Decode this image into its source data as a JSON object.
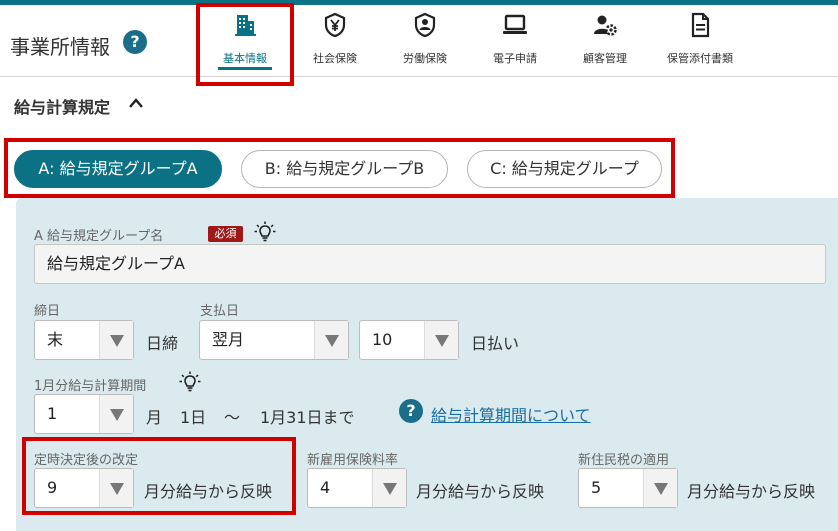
{
  "header": {
    "title": "事業所情報",
    "help_glyph": "?"
  },
  "tabs": [
    {
      "label": "基本情報",
      "icon": "building-icon",
      "active": true
    },
    {
      "label": "社会保険",
      "icon": "yen-shield-icon"
    },
    {
      "label": "労働保険",
      "icon": "person-shield-icon"
    },
    {
      "label": "電子申請",
      "icon": "laptop-icon"
    },
    {
      "label": "顧客管理",
      "icon": "user-gear-icon"
    },
    {
      "label": "保管添付書類",
      "icon": "document-icon"
    }
  ],
  "section": {
    "title": "給与計算規定",
    "toggle_icon": "chevron-up-icon"
  },
  "groups": [
    {
      "label": "A: 給与規定グループA",
      "active": true
    },
    {
      "label": "B: 給与規定グループB"
    },
    {
      "label": "C: 給与規定グループ"
    }
  ],
  "form": {
    "group_name": {
      "label": "A 給与規定グループ名",
      "required": "必須",
      "value": "給与規定グループA"
    },
    "closing_day": {
      "label": "締日",
      "value": "末",
      "suffix": "日締"
    },
    "payday": {
      "label": "支払日",
      "month_value": "翌月",
      "day_value": "10",
      "suffix": "日払い"
    },
    "period": {
      "label": "1月分給与計算期間",
      "value": "1",
      "month_suffix": "月",
      "start": "1日",
      "tilde": "～",
      "end": "1月31日まで",
      "help_link": "給与計算期間について"
    },
    "teiji": {
      "label": "定時決定後の改定",
      "value": "9",
      "suffix": "月分給与から反映"
    },
    "koyou": {
      "label": "新雇用保険料率",
      "value": "4",
      "suffix": "月分給与から反映"
    },
    "juumin": {
      "label": "新住民税の適用",
      "value": "5",
      "suffix": "月分給与から反映"
    }
  },
  "colors": {
    "accent": "#0b7285",
    "highlight": "#d00000",
    "panel": "#dbeaee",
    "required": "#a01818",
    "link": "#1a6ea0"
  }
}
